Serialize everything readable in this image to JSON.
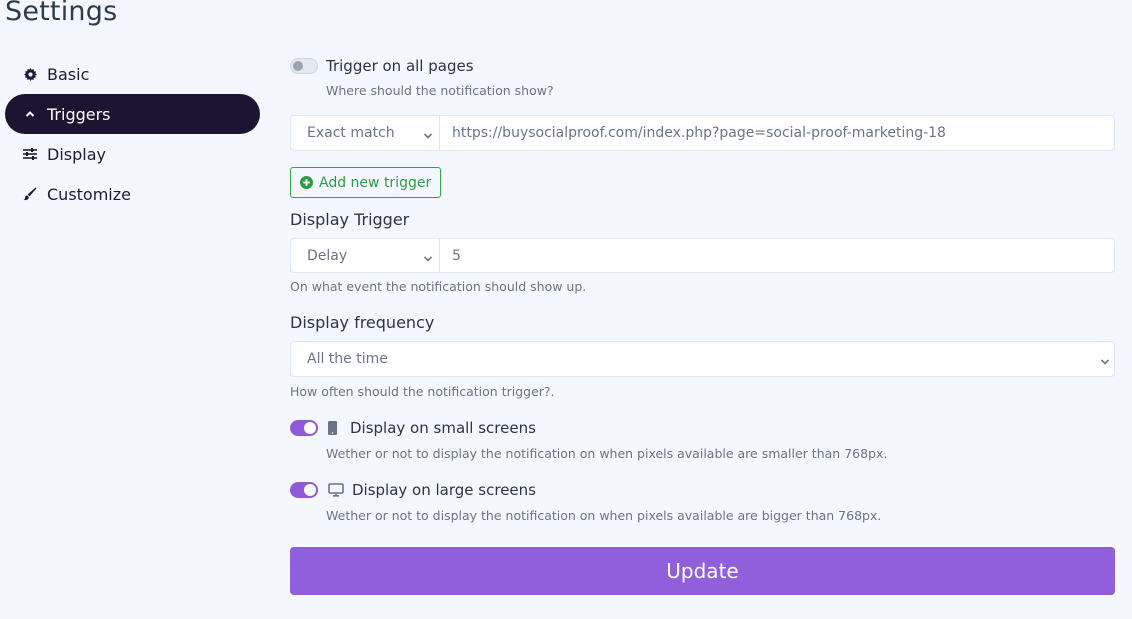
{
  "page": {
    "title": "Settings"
  },
  "sidebar": {
    "items": [
      {
        "label": "Basic",
        "icon": "gear-icon",
        "active": false
      },
      {
        "label": "Triggers",
        "icon": "chevron-up-icon",
        "active": true
      },
      {
        "label": "Display",
        "icon": "sliders-icon",
        "active": false
      },
      {
        "label": "Customize",
        "icon": "paintbrush-icon",
        "active": false
      }
    ]
  },
  "triggers": {
    "all_pages": {
      "label": "Trigger on all pages",
      "help": "Where should the notification show?",
      "enabled": false
    },
    "rule": {
      "match_type": "Exact match",
      "url": "https://buysocialproof.com/index.php?page=social-proof-marketing-18"
    },
    "add_trigger_label": "Add new trigger"
  },
  "display_trigger": {
    "label": "Display Trigger",
    "type": "Delay",
    "value": "5",
    "help": "On what event the notification should show up."
  },
  "display_frequency": {
    "label": "Display frequency",
    "value": "All the time",
    "help": "How often should the notification trigger?."
  },
  "small_screens": {
    "label": "Display on small screens",
    "help": "Wether or not to display the notification on when pixels available are smaller than 768px.",
    "enabled": true,
    "icon": "mobile-icon"
  },
  "large_screens": {
    "label": "Display on large screens",
    "help": "Wether or not to display the notification on when pixels available are bigger than 768px.",
    "enabled": true,
    "icon": "desktop-icon"
  },
  "update_label": "Update",
  "colors": {
    "accent": "#905fdc",
    "nav_active": "#1b1531",
    "success": "#31a24c",
    "background": "#f4f7fd"
  }
}
